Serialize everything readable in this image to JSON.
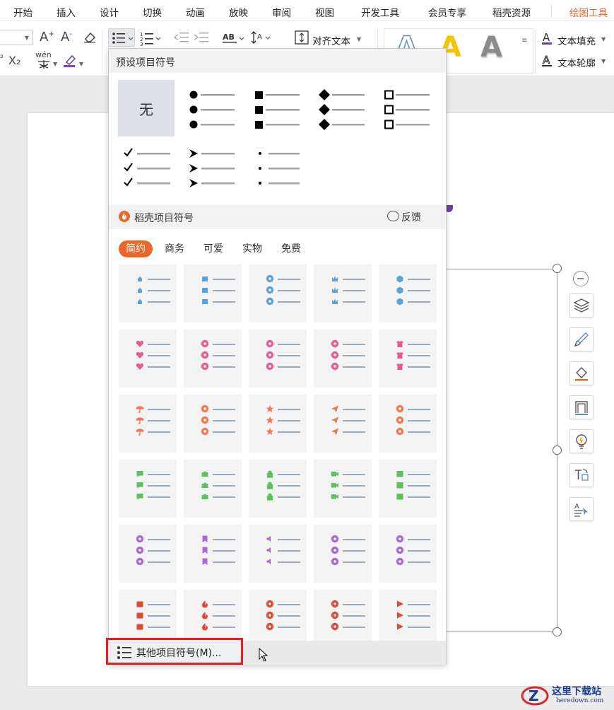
{
  "menu": {
    "items": [
      "开始",
      "插入",
      "设计",
      "切换",
      "动画",
      "放映",
      "审阅",
      "视图",
      "开发工具",
      "会员专享",
      "稻壳资源",
      "绘图工具"
    ],
    "active": "绘图工具",
    "accent": "#e8672a"
  },
  "toolbar": {
    "superscript": "²",
    "subscript": "X₂",
    "phonetic": "wén",
    "align_text_label": "对齐文本",
    "text_fill_label": "文本填充",
    "text_outline_label": "文本轮廓",
    "style_samples": [
      "A",
      "A",
      "A"
    ]
  },
  "dropdown": {
    "preset_title": "预设项目符号",
    "none_label": "无",
    "preset_icons": [
      "none",
      "filled-circle",
      "filled-square",
      "filled-diamond",
      "hollow-square",
      "checkmark",
      "arrowhead",
      "small-dot"
    ],
    "docer_title": "稻壳项目符号",
    "feedback_label": "反馈",
    "tabs": [
      "简约",
      "商务",
      "可爱",
      "实物",
      "免费"
    ],
    "active_tab": "简约",
    "grid": [
      [
        {
          "icon": "house-icon",
          "color": "#5aa2d8"
        },
        {
          "icon": "wallet-icon",
          "color": "#5aa2d8"
        },
        {
          "icon": "search-icon",
          "color": "#5aa2d8"
        },
        {
          "icon": "crown-icon",
          "color": "#5aa2d8"
        },
        {
          "icon": "cube-icon",
          "color": "#5aa2d8"
        }
      ],
      [
        {
          "icon": "heart-icon",
          "color": "#ea5a95"
        },
        {
          "icon": "chevron-left-icon",
          "color": "#ea5a95"
        },
        {
          "icon": "chevron-right-icon",
          "color": "#ea5a95"
        },
        {
          "icon": "close-circle-icon",
          "color": "#ea5a95"
        },
        {
          "icon": "shirt-icon",
          "color": "#ea5a95"
        }
      ],
      [
        {
          "icon": "umbrella-icon",
          "color": "#ef7a55"
        },
        {
          "icon": "microphone-icon",
          "color": "#ef7a55"
        },
        {
          "icon": "star-icon",
          "color": "#ef7a55"
        },
        {
          "icon": "paper-plane-icon",
          "color": "#ef7a55"
        },
        {
          "icon": "medal-icon",
          "color": "#ef7a55"
        }
      ],
      [
        {
          "icon": "chat-icon",
          "color": "#5fbf5a"
        },
        {
          "icon": "camera-icon",
          "color": "#5fbf5a"
        },
        {
          "icon": "lock-icon",
          "color": "#5fbf5a"
        },
        {
          "icon": "video-icon",
          "color": "#5fbf5a"
        },
        {
          "icon": "inbox-icon",
          "color": "#5fbf5a"
        }
      ],
      [
        {
          "icon": "smile-icon",
          "color": "#a66ad8"
        },
        {
          "icon": "bookmark-icon",
          "color": "#a66ad8"
        },
        {
          "icon": "speaker-icon",
          "color": "#a66ad8"
        },
        {
          "icon": "info-icon",
          "color": "#a66ad8"
        },
        {
          "icon": "location-pin-icon",
          "color": "#a66ad8"
        }
      ],
      [
        {
          "icon": "database-icon",
          "color": "#de4a3a"
        },
        {
          "icon": "flame-icon",
          "color": "#de4a3a"
        },
        {
          "icon": "target-icon",
          "color": "#de4a3a"
        },
        {
          "icon": "check-circle-icon",
          "color": "#de4a3a"
        },
        {
          "icon": "play-icon",
          "color": "#de4a3a"
        }
      ]
    ],
    "more_label": "其他项目符号(M)..."
  },
  "watermark": {
    "text": "这里下载站",
    "url": "heredown.com"
  }
}
